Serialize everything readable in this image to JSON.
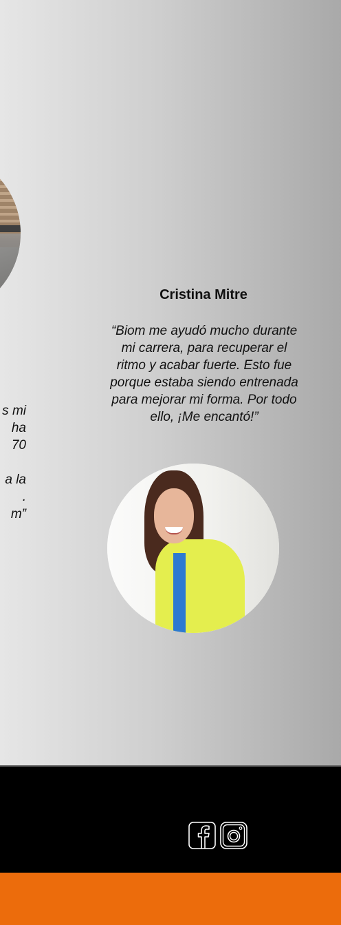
{
  "testimonials": {
    "left": {
      "quote_fragment": "s mi\nha\n70\n\na la\n.\nm”"
    },
    "right": {
      "name": "Cristina Mitre",
      "quote": "“Biom me ayudó mucho durante mi carrera, para recuperar el ritmo y acabar fuerte. Esto fue porque estaba siendo entrenada para mejorar mi forma. Por todo ello, ¡Me encantó!”"
    }
  },
  "footer": {
    "icons": [
      "facebook-icon",
      "instagram-icon"
    ]
  },
  "colors": {
    "footer_background": "#000000",
    "bottom_bar": "#ec6c0c",
    "text": "#111111"
  }
}
